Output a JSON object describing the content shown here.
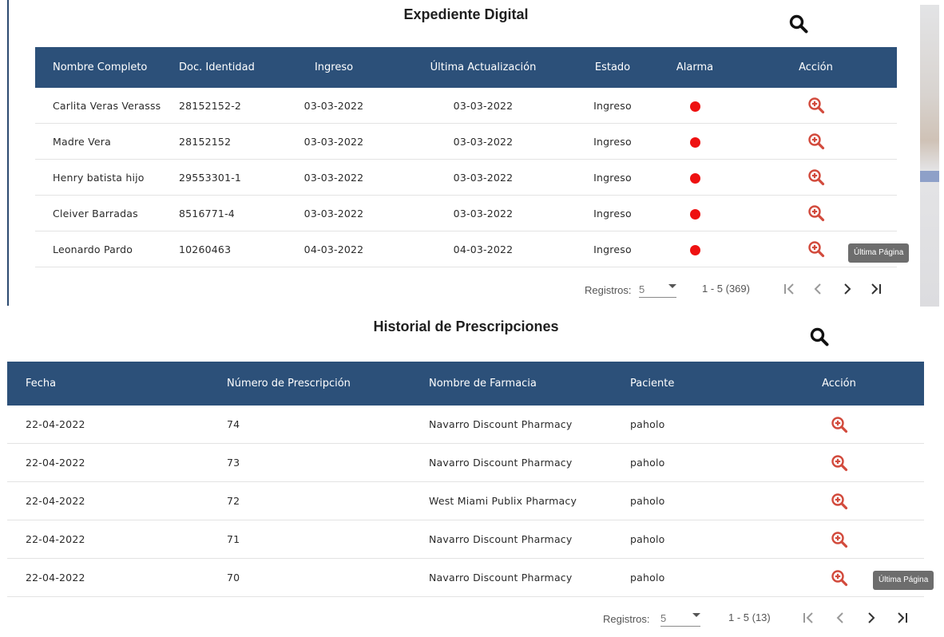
{
  "colors": {
    "header_bg": "#2c5079",
    "alarm": "#ee1111",
    "zoom_icon": "#d24a3c",
    "tooltip_bg": "#6d6d6d"
  },
  "expediente": {
    "title": "Expediente Digital",
    "search_icon": "search-icon",
    "columns": [
      "Nombre Completo",
      "Doc. Identidad",
      "Ingreso",
      "Última Actualización",
      "Estado",
      "Alarma",
      "Acción"
    ],
    "rows": [
      {
        "nombre": "Carlita Veras Verasss",
        "doc": "28152152-2",
        "ingreso": "03-03-2022",
        "actualizacion": "03-03-2022",
        "estado": "Ingreso"
      },
      {
        "nombre": "Madre Vera",
        "doc": "28152152",
        "ingreso": "03-03-2022",
        "actualizacion": "03-03-2022",
        "estado": "Ingreso"
      },
      {
        "nombre": "Henry batista hijo",
        "doc": "29553301-1",
        "ingreso": "03-03-2022",
        "actualizacion": "03-03-2022",
        "estado": "Ingreso"
      },
      {
        "nombre": "Cleiver Barradas",
        "doc": "8516771-4",
        "ingreso": "03-03-2022",
        "actualizacion": "03-03-2022",
        "estado": "Ingreso"
      },
      {
        "nombre": "Leonardo Pardo",
        "doc": "10260463",
        "ingreso": "04-03-2022",
        "actualizacion": "04-03-2022",
        "estado": "Ingreso"
      }
    ],
    "tooltip": "Última Página",
    "paginator": {
      "label": "Registros:",
      "page_size": "5",
      "range": "1 - 5 (369)"
    }
  },
  "historial": {
    "title": "Historial de Prescripciones",
    "search_icon": "search-icon",
    "columns": [
      "Fecha",
      "Número de Prescripción",
      "Nombre de Farmacia",
      "Paciente",
      "Acción"
    ],
    "rows": [
      {
        "fecha": "22-04-2022",
        "numero": "74",
        "farmacia": "Navarro Discount Pharmacy",
        "paciente": "paholo"
      },
      {
        "fecha": "22-04-2022",
        "numero": "73",
        "farmacia": "Navarro Discount Pharmacy",
        "paciente": "paholo"
      },
      {
        "fecha": "22-04-2022",
        "numero": "72",
        "farmacia": "West Miami Publix Pharmacy",
        "paciente": "paholo"
      },
      {
        "fecha": "22-04-2022",
        "numero": "71",
        "farmacia": "Navarro Discount Pharmacy",
        "paciente": "paholo"
      },
      {
        "fecha": "22-04-2022",
        "numero": "70",
        "farmacia": "Navarro Discount Pharmacy",
        "paciente": "paholo"
      }
    ],
    "tooltip": "Última Página",
    "paginator": {
      "label": "Registros:",
      "page_size": "5",
      "range": "1 - 5 (13)"
    }
  }
}
